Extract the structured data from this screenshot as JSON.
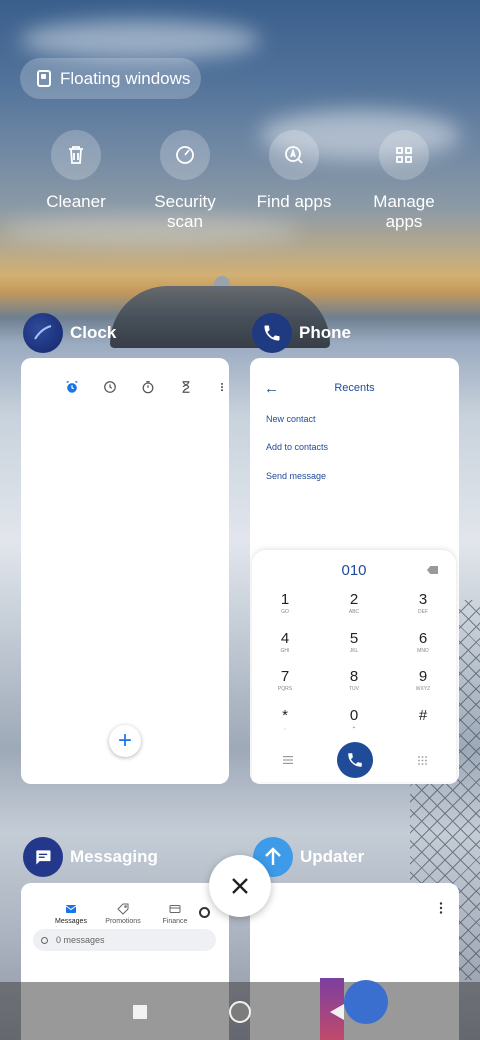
{
  "floating": {
    "label": "Floating windows"
  },
  "quick_actions": [
    {
      "label": "Cleaner",
      "icon": "trash-icon"
    },
    {
      "label": "Security\nscan",
      "icon": "gauge-icon"
    },
    {
      "label": "Find apps",
      "icon": "find-apps-icon"
    },
    {
      "label": "Manage\napps",
      "icon": "grid-icon"
    }
  ],
  "apps": {
    "clock": {
      "name": "Clock",
      "icon": "clock-app-icon"
    },
    "phone": {
      "name": "Phone",
      "icon": "phone-app-icon",
      "title": "Recents",
      "links": [
        "New contact",
        "Add to contacts",
        "Send message"
      ],
      "dialed": "010",
      "keys": [
        {
          "digit": "1",
          "letters": "GO"
        },
        {
          "digit": "2",
          "letters": "ABC"
        },
        {
          "digit": "3",
          "letters": "DEF"
        },
        {
          "digit": "4",
          "letters": "GHI"
        },
        {
          "digit": "5",
          "letters": "JKL"
        },
        {
          "digit": "6",
          "letters": "MNO"
        },
        {
          "digit": "7",
          "letters": "PQRS"
        },
        {
          "digit": "8",
          "letters": "TUV"
        },
        {
          "digit": "9",
          "letters": "WXYZ"
        },
        {
          "digit": "*",
          "letters": ","
        },
        {
          "digit": "0",
          "letters": "+"
        },
        {
          "digit": "#",
          "letters": ""
        }
      ]
    },
    "messaging": {
      "name": "Messaging",
      "icon": "messaging-app-icon",
      "tabs": [
        "Messages",
        "Promotions",
        "Finance"
      ],
      "search": "0 messages"
    },
    "updater": {
      "name": "Updater",
      "icon": "updater-app-icon"
    }
  },
  "colors": {
    "phone_accent": "#1f4b99",
    "clock_accent": "#1a73e8",
    "updater_icon": "#3d9be9"
  }
}
